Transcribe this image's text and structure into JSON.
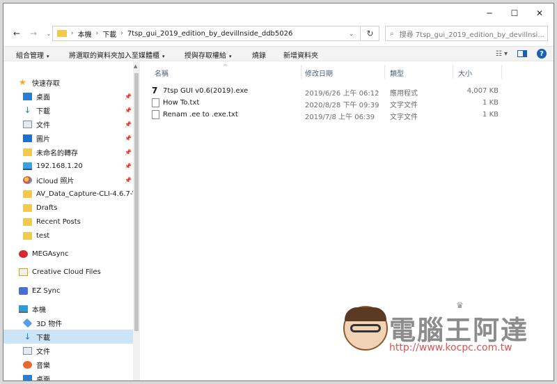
{
  "window": {
    "minimize": "─",
    "maximize": "☐",
    "close": "✕"
  },
  "address": {
    "back": "←",
    "forward": "→",
    "recent": "⌄",
    "crumbs": [
      "本機",
      "下載",
      "7tsp_gui_2019_edition_by_devillnside_ddb5026"
    ],
    "separator": "›",
    "dropdown": "⌄",
    "refresh": "↻",
    "search_icon": "⌕",
    "search_placeholder": "搜尋 7tsp_gui_2019_edition_by_devillnsi..."
  },
  "toolbar": {
    "organize": "組合管理",
    "add_to_library": "將選取的資料夾加入至媒體櫃",
    "share": "授與存取權給",
    "burn": "燒錄",
    "new_folder": "新增資料夾",
    "caret": "▾",
    "view_icon": "☷ ▾",
    "help": "?"
  },
  "sidebar": {
    "quick_access": "快速存取",
    "items": [
      {
        "label": "桌面",
        "icon": "desktop-icon",
        "pinned": true
      },
      {
        "label": "下載",
        "icon": "download-icon",
        "pinned": true
      },
      {
        "label": "文件",
        "icon": "documents-icon",
        "pinned": true
      },
      {
        "label": "圖片",
        "icon": "pictures-icon",
        "pinned": true
      },
      {
        "label": "未命名的轉存",
        "icon": "folder-icon",
        "pinned": true
      },
      {
        "label": "192.168.1.20",
        "icon": "network-drive-icon",
        "pinned": true
      },
      {
        "label": "iCloud 照片",
        "icon": "icloud-photos-icon",
        "pinned": true
      },
      {
        "label": "AV_Data_Capture-CLI-4.6.7-V",
        "icon": "folder-icon",
        "pinned": false
      },
      {
        "label": "Drafts",
        "icon": "folder-icon",
        "pinned": false
      },
      {
        "label": "Recent Posts",
        "icon": "folder-icon",
        "pinned": false
      },
      {
        "label": "test",
        "icon": "folder-icon",
        "pinned": false
      }
    ],
    "mega": "MEGAsync",
    "creative_cloud": "Creative Cloud Files",
    "ez_sync": "EZ Sync",
    "this_pc": "本機",
    "pc_items": [
      {
        "label": "3D 物件",
        "icon": "3d-objects-icon"
      },
      {
        "label": "下載",
        "icon": "download-icon"
      },
      {
        "label": "文件",
        "icon": "documents-icon"
      },
      {
        "label": "音樂",
        "icon": "music-icon"
      },
      {
        "label": "桌面",
        "icon": "desktop-icon"
      }
    ],
    "pin_glyph": "📌"
  },
  "columns": {
    "name": "名稱",
    "modified": "修改日期",
    "type": "類型",
    "size": "大小",
    "sort_glyph": "^"
  },
  "files": [
    {
      "name": "7tsp GUI v0.6(2019).exe",
      "modified": "2019/6/26 上午 06:12",
      "type": "應用程式",
      "size": "4,007 KB",
      "icon": "7tsp-app-icon"
    },
    {
      "name": "How To.txt",
      "modified": "2020/8/28 下午 09:39",
      "type": "文字文件",
      "size": "1 KB",
      "icon": "text-file-icon"
    },
    {
      "name": "Renam .ee to .exe.txt",
      "modified": "2019/7/8 上午 06:39",
      "type": "文字文件",
      "size": "1 KB",
      "icon": "text-file-icon"
    }
  ],
  "watermark": {
    "title": "電腦王阿達",
    "url": "http://www.kocpc.com.tw"
  },
  "colors": {
    "accent": "#1a5fb4",
    "selection": "#cce4f7",
    "folder": "#f2c94c"
  }
}
